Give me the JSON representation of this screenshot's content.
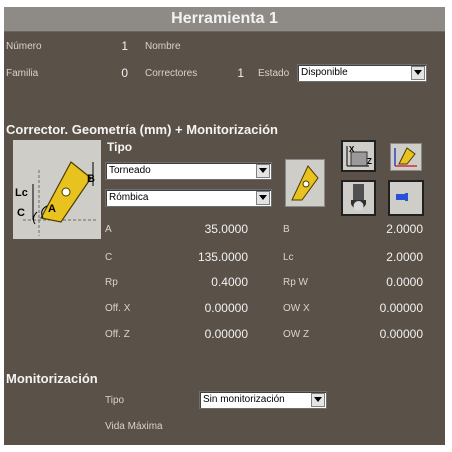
{
  "title": "Herramienta 1",
  "header": {
    "numero_label": "Número",
    "numero_value": "1",
    "nombre_label": "Nombre",
    "familia_label": "Familia",
    "familia_value": "0",
    "correctores_label": "Correctores",
    "correctores_value": "1",
    "estado_label": "Estado",
    "estado_value": "Disponible"
  },
  "corrector": {
    "section_title": "Corrector. Geometría (mm) + Monitorización",
    "diagram_labels": {
      "lc": "Lc",
      "c": "C",
      "a": "A",
      "b": "B"
    },
    "tipo_label": "Tipo",
    "tipo_value": "Torneado",
    "shape_value": "Rómbica",
    "params": [
      {
        "left_label": "A",
        "left_value": "35.0000",
        "right_label": "B",
        "right_value": "2.0000"
      },
      {
        "left_label": "C",
        "left_value": "135.0000",
        "right_label": "Lc",
        "right_value": "2.0000"
      },
      {
        "left_label": "Rp",
        "left_value": "0.4000",
        "right_label": "Rp W",
        "right_value": "0.0000"
      },
      {
        "left_label": "Off. X",
        "left_value": "0.00000",
        "right_label": "OW X",
        "right_value": "0.00000"
      },
      {
        "left_label": "Off. Z",
        "left_value": "0.00000",
        "right_label": "OW Z",
        "right_value": "0.00000"
      }
    ],
    "axis_icon_labels": {
      "x": "X",
      "z": "Z"
    }
  },
  "monitorizacion": {
    "section_title": "Monitorización",
    "tipo_label": "Tipo",
    "tipo_value": "Sin monitorización",
    "vida_label": "Vida Máxima"
  },
  "colors": {
    "panel": "#5a5148",
    "titlebar": "#8e8a85",
    "insert_gold": "#e8c21e"
  }
}
